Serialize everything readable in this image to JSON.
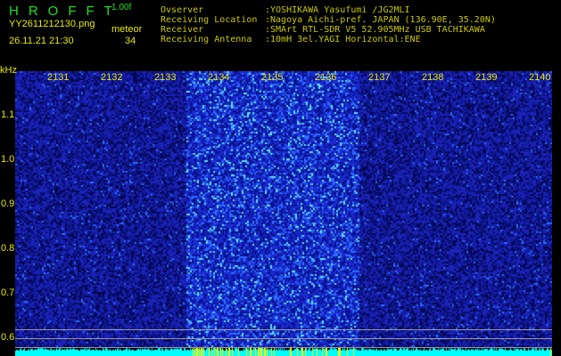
{
  "header": {
    "app_title": "HROFFT",
    "version": "1.00f",
    "filename": "YY2611212130.png",
    "datetime": "26.11.21 21:30",
    "meteor_label": "meteor",
    "meteor_count": "34"
  },
  "info": [
    {
      "key": "Ovserver",
      "value": ":YOSHIKAWA Yasufumi /JG2MLI"
    },
    {
      "key": "Receiving Location",
      "value": ":Nagoya Aichi-pref. JAPAN (136.90E, 35.20N)"
    },
    {
      "key": "Receiver",
      "value": ":SMArt RTL-SDR V5 52.905MHz USB TACHIKAWA"
    },
    {
      "key": "Receiving Antenna",
      "value": ":10mH 3el.YAGI Horizontal:ENE"
    }
  ],
  "spectrogram": {
    "x_unit": "kHz",
    "x_ticks": [
      "2131",
      "2132",
      "2133",
      "2134",
      "2135",
      "2136",
      "2137",
      "2138",
      "2139",
      "2140"
    ],
    "y_ticks": [
      "1.1",
      "1.0",
      "0.9",
      "0.8",
      "0.7",
      "0.6"
    ],
    "colors": {
      "background": "#000000",
      "noise": "#1a2ad0",
      "activity": "#4fc8ff",
      "baseline": "#00ffff",
      "meteor_marker": "#ffff00",
      "text": "#e8e800",
      "title": "#22e022"
    }
  }
}
